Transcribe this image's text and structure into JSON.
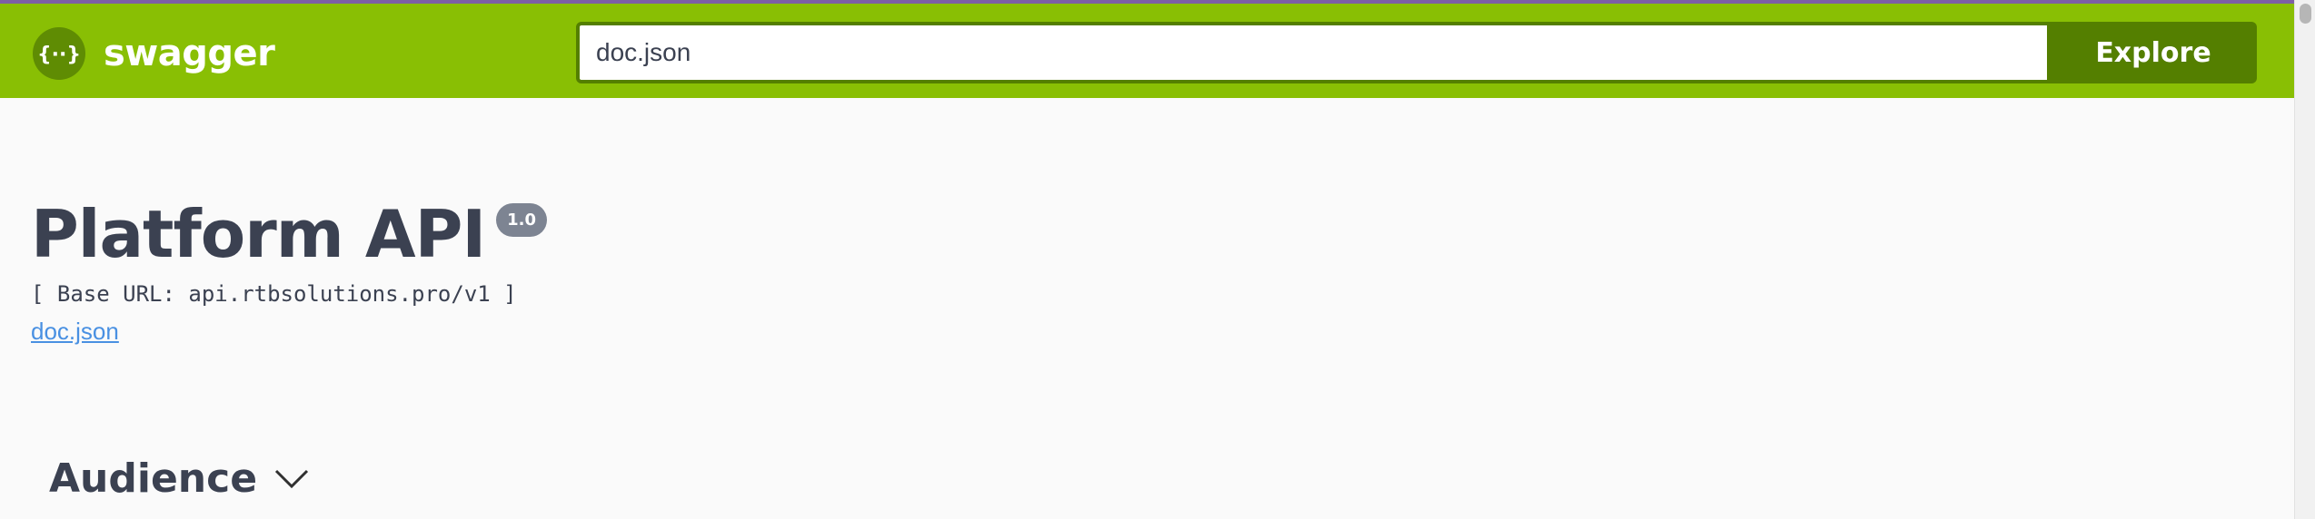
{
  "colors": {
    "topbar": "#89bf04",
    "topbar_dark": "#547f00",
    "accent_line": "#7d5fa6",
    "title_text": "#3b4151",
    "badge": "#7d8492",
    "link": "#4990e2",
    "background": "#fafafa"
  },
  "topbar": {
    "logo_icon": "swagger-braces-icon",
    "logo_text": "swagger",
    "url_value": "doc.json",
    "explore_label": "Explore"
  },
  "info": {
    "title": "Platform API",
    "version": "1.0",
    "base_url": "[ Base URL: api.rtbsolutions.pro/v1 ]",
    "spec_link": "doc.json"
  },
  "tags": [
    {
      "name": "Audience",
      "icon": "chevron-down-icon"
    }
  ]
}
